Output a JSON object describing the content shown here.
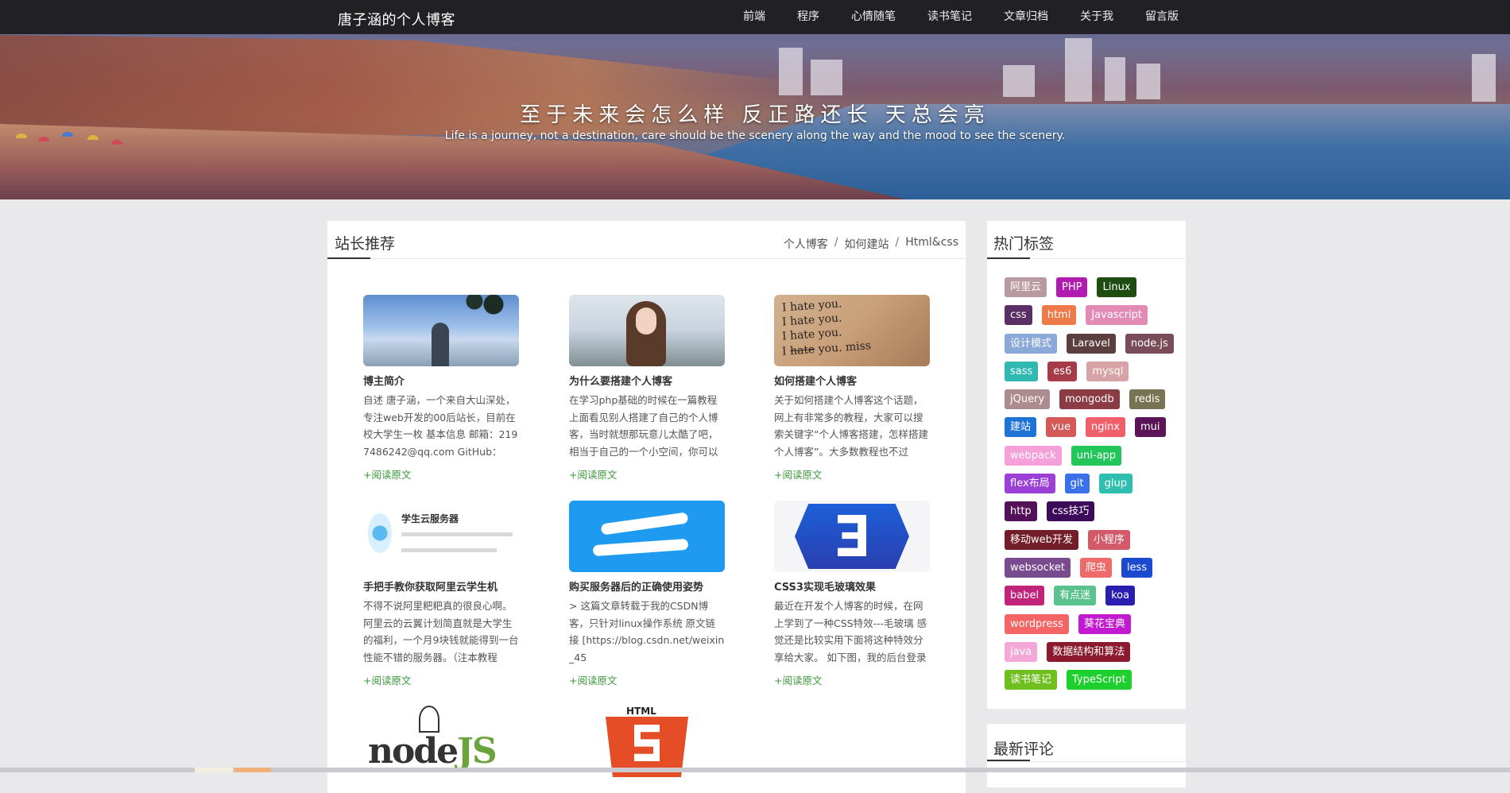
{
  "header": {
    "site_title": "唐子涵的个人博客",
    "nav": [
      "前端",
      "程序",
      "心情随笔",
      "读书笔记",
      "文章归档",
      "关于我",
      "留言版"
    ]
  },
  "banner": {
    "title": "至于未来会怎么样 反正路还长 天总会亮",
    "subtitle": "Life is a journey, not a destination, care should be the scenery along the way and the mood to see the scenery."
  },
  "main": {
    "title": "站长推荐",
    "breadcrumb": [
      "个人博客",
      "如何建站",
      "Html&css"
    ],
    "read_more": "+阅读原文",
    "articles": [
      {
        "title": "博主简介",
        "excerpt": "自述 唐子涵，一个来自大山深处，专注web开发的00后站长，目前在校大学生一枚 基本信息 邮箱：2197486242@qq.com GitHub：",
        "thumb": "person-under-tree-photo"
      },
      {
        "title": "为什么要搭建个人博客",
        "excerpt": "在学习php基础的时候在一篇教程上面看见别人搭建了自己的个人博客，当时就想那玩意儿太酷了吧，相当于自己的一个小空间，你可以",
        "thumb": "girl-portrait-photo"
      },
      {
        "title": "如何搭建个人博客",
        "excerpt": "关于如何搭建个人博客这个话题，网上有非常多的教程，大家可以搜索关键字“个人博客搭建，怎样搭建个人博客”。大多数教程也不过",
        "thumb": "i-hate-you-note-photo"
      },
      {
        "title": "手把手教你获取阿里云学生机",
        "excerpt": "不得不说阿里粑粑真的很良心啊。阿里云的云翼计划简直就是大学生的福利，一个月9块钱就能得到一台性能不错的服务器。（注本教程",
        "thumb": "student-cloud-server-banner",
        "thumb_text": "学生云服务器"
      },
      {
        "title": "购买服务器后的正确使用姿势",
        "excerpt": "> 这篇文章转载于我的CSDN博客，只针对linux操作系统 原文链接 [https://blog.csdn.net/weixin_45",
        "thumb": "cloud-logo"
      },
      {
        "title": "CSS3实现毛玻璃效果",
        "excerpt": "最近在开发个人博客的时候，在网上学到了一种CSS特效---毛玻璃 感觉还是比较实用下面将这种特效分享给大家。 如下图，我的后台登录",
        "thumb": "css3-logo"
      },
      {
        "title": "",
        "excerpt": "",
        "thumb": "nodejs-logo"
      },
      {
        "title": "",
        "excerpt": "",
        "thumb": "html5-logo",
        "thumb_text": "HTML"
      }
    ]
  },
  "sidebar": {
    "tags_title": "热门标签",
    "tag_rows": [
      [
        {
          "label": "阿里云",
          "color": "#b99a9e"
        },
        {
          "label": "PHP",
          "color": "#b21bb0"
        },
        {
          "label": "Linux",
          "color": "#1e4d12"
        }
      ],
      [
        {
          "label": "css",
          "color": "#5a2f66"
        },
        {
          "label": "html",
          "color": "#ee7a4a"
        },
        {
          "label": "Javascript",
          "color": "#e38ab5"
        }
      ],
      [
        {
          "label": "设计模式",
          "color": "#8aa8d8"
        },
        {
          "label": "Laravel",
          "color": "#5b3f3f"
        },
        {
          "label": "node.js",
          "color": "#7a4c5a"
        }
      ],
      [
        {
          "label": "sass",
          "color": "#2fb9b2"
        },
        {
          "label": "es6",
          "color": "#a63c48"
        },
        {
          "label": "mysql",
          "color": "#d7a3a6"
        }
      ],
      [
        {
          "label": "jQuery",
          "color": "#ad8c8f"
        },
        {
          "label": "mongodb",
          "color": "#8a3b44"
        },
        {
          "label": "redis",
          "color": "#767452"
        }
      ],
      [
        {
          "label": "建站",
          "color": "#1e73d6"
        },
        {
          "label": "vue",
          "color": "#d45a5a"
        },
        {
          "label": "nginx",
          "color": "#f0606a"
        },
        {
          "label": "mui",
          "color": "#5c1458"
        }
      ],
      [
        {
          "label": "webpack",
          "color": "#f6a0da"
        },
        {
          "label": "uni-app",
          "color": "#23c65a"
        }
      ],
      [
        {
          "label": "flex布局",
          "color": "#9a40d6"
        },
        {
          "label": "git",
          "color": "#3a70ea"
        },
        {
          "label": "glup",
          "color": "#2fbfb0"
        }
      ],
      [
        {
          "label": "http",
          "color": "#531158"
        },
        {
          "label": "css技巧",
          "color": "#3d0a5a"
        }
      ],
      [
        {
          "label": "移动web开发",
          "color": "#731c2a"
        },
        {
          "label": "小程序",
          "color": "#d45a6a"
        }
      ],
      [
        {
          "label": "websocket",
          "color": "#7a4a8e"
        },
        {
          "label": "爬虫",
          "color": "#f06a6a"
        },
        {
          "label": "less",
          "color": "#1a4ad0"
        }
      ],
      [
        {
          "label": "babel",
          "color": "#c2237a"
        },
        {
          "label": "有点迷",
          "color": "#5bc28e"
        },
        {
          "label": "koa",
          "color": "#2a1eb0"
        }
      ],
      [
        {
          "label": "wordpress",
          "color": "#f56565"
        },
        {
          "label": "葵花宝典",
          "color": "#c21ad0"
        }
      ],
      [
        {
          "label": "java",
          "color": "#f4a8d8"
        },
        {
          "label": "数据结构和算法",
          "color": "#8c1a2e"
        }
      ],
      [
        {
          "label": "读书笔记",
          "color": "#6fbf1e"
        },
        {
          "label": "TypeScript",
          "color": "#1ed02e"
        }
      ]
    ],
    "comments_title": "最新评论"
  }
}
